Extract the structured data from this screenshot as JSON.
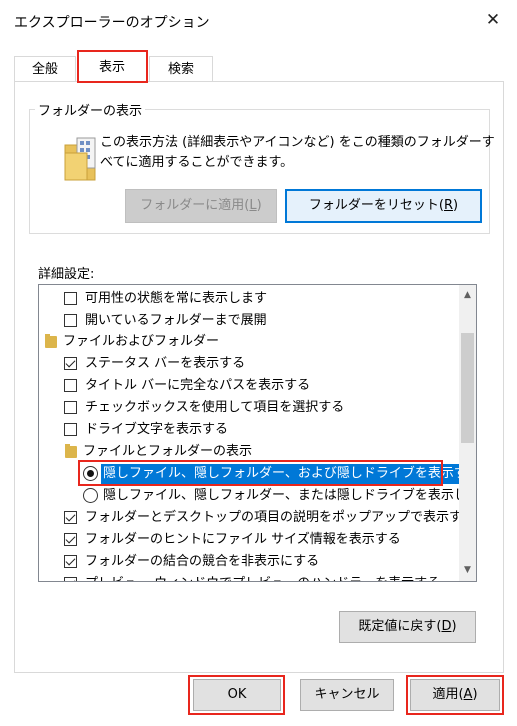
{
  "window": {
    "title": "エクスプローラーのオプション",
    "close_icon": "close-icon"
  },
  "tabs": [
    {
      "label": "全般",
      "active": false
    },
    {
      "label": "表示",
      "active": true
    },
    {
      "label": "検索",
      "active": false
    }
  ],
  "folder_view": {
    "group_label": "フォルダーの表示",
    "description_line1": "この表示方法 (詳細表示やアイコンなど) をこの種類のフォルダーす",
    "description_line2": "べてに適用することができます。",
    "apply_button": {
      "text": "フォルダーに適用(",
      "key": "L",
      "tail": ")",
      "enabled": false
    },
    "reset_button": {
      "text": "フォルダーをリセット(",
      "key": "R",
      "tail": ")"
    }
  },
  "advanced": {
    "label": "詳細設定:",
    "items": [
      {
        "type": "checkbox",
        "checked": false,
        "label": "可用性の状態を常に表示します"
      },
      {
        "type": "checkbox",
        "checked": false,
        "label": "開いているフォルダーまで展開"
      },
      {
        "type": "folder",
        "label": "ファイルおよびフォルダー"
      },
      {
        "type": "checkbox",
        "checked": true,
        "label": "ステータス バーを表示する"
      },
      {
        "type": "checkbox",
        "checked": false,
        "label": "タイトル バーに完全なパスを表示する"
      },
      {
        "type": "checkbox",
        "checked": false,
        "label": "チェックボックスを使用して項目を選択する"
      },
      {
        "type": "checkbox",
        "checked": false,
        "label": "ドライブ文字を表示する"
      },
      {
        "type": "folder",
        "label": "ファイルとフォルダーの表示"
      },
      {
        "type": "radio",
        "selected": true,
        "label": "隠しファイル、隠しフォルダー、および隠しドライブを表示する"
      },
      {
        "type": "radio",
        "selected": false,
        "label": "隠しファイル、隠しフォルダー、または隠しドライブを表示しない"
      },
      {
        "type": "checkbox",
        "checked": true,
        "label": "フォルダーとデスクトップの項目の説明をポップアップで表示する"
      },
      {
        "type": "checkbox",
        "checked": true,
        "label": "フォルダーのヒントにファイル サイズ情報を表示する"
      },
      {
        "type": "checkbox",
        "checked": true,
        "label": "フォルダーの結合の競合を非表示にする"
      },
      {
        "type": "checkbox",
        "checked": true,
        "label": "プレビュー ウィンドウでプレビューのハンドラーを表示する"
      }
    ],
    "restore_button": {
      "text": "既定値に戻す(",
      "key": "D",
      "tail": ")"
    }
  },
  "footer": {
    "ok": "OK",
    "cancel": "キャンセル",
    "apply": {
      "text": "適用(",
      "key": "A",
      "tail": ")"
    }
  },
  "colors": {
    "highlight": "#0078d7",
    "annotation_red": "#e8261d",
    "folder": "#dcb54b"
  }
}
